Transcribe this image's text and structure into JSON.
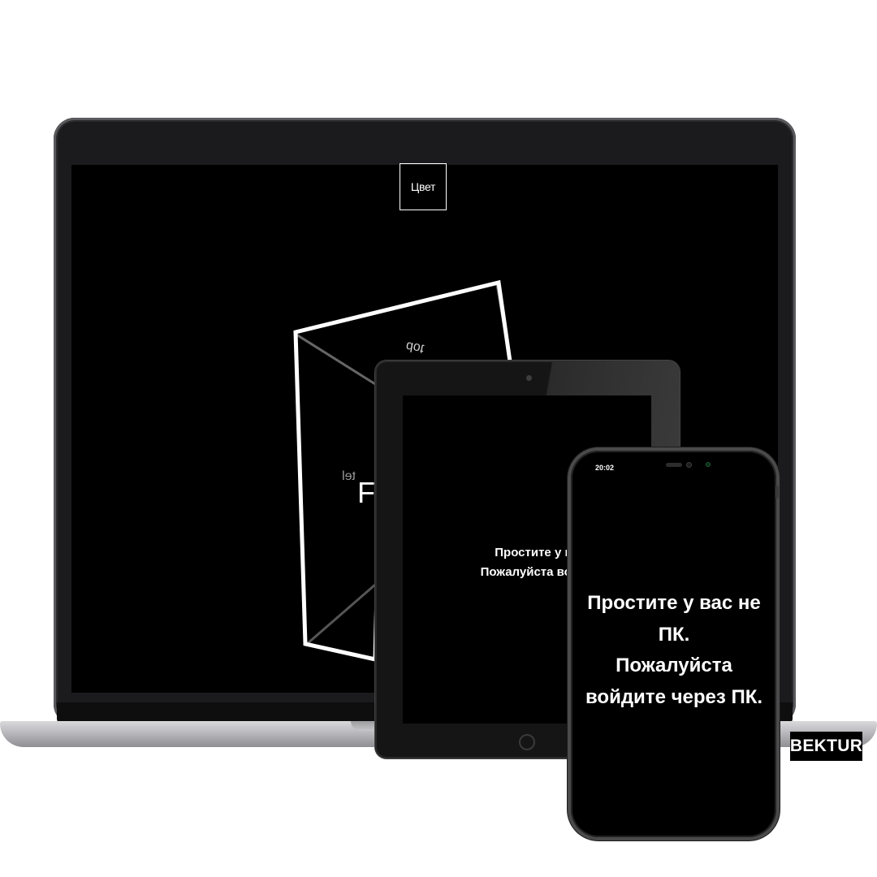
{
  "laptop": {
    "color_button_label": "Цвет",
    "cube": {
      "mirrored_label": "dot",
      "side_label": "tel",
      "front_label": "Fr"
    }
  },
  "tablet": {
    "message_line1": "Простите у вас не",
    "message_line2": "Пожалуйста войдите ч"
  },
  "phone": {
    "status_time": "20:02",
    "message_line1": "Простите у вас не",
    "message_line2": "ПК.",
    "message_line3": "Пожалуйста",
    "message_line4": "войдите через ПК."
  },
  "brand": {
    "label": "BEKTUR"
  },
  "colors": {
    "background": "#ffffff",
    "screen": "#000000",
    "text": "#ffffff",
    "device_frame": "#1b1b1d",
    "laptop_base": "#b9b9bd"
  }
}
